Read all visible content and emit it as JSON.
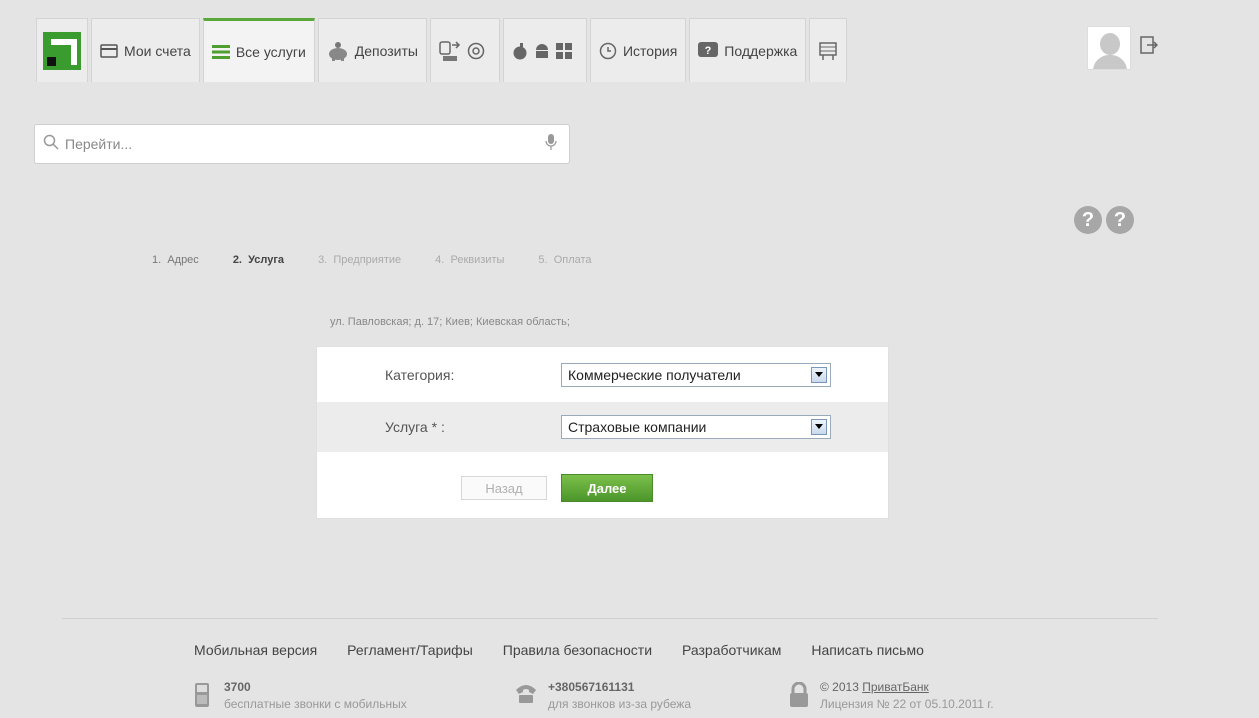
{
  "tabs": {
    "accounts_label": "Мои счета",
    "services_label": "Все услуги",
    "deposits_label": "Депозиты",
    "history_label": "История",
    "support_label": "Поддержка"
  },
  "search": {
    "placeholder": "Перейти..."
  },
  "steps": [
    {
      "num": "1.",
      "label": "Адрес"
    },
    {
      "num": "2.",
      "label": "Услуга"
    },
    {
      "num": "3.",
      "label": "Предприятие"
    },
    {
      "num": "4.",
      "label": "Реквизиты"
    },
    {
      "num": "5.",
      "label": "Оплата"
    }
  ],
  "address": "ул. Павловская; д. 17; Киев; Киевская область;",
  "form": {
    "category_label": "Категория:",
    "category_value": "Коммерческие получатели",
    "service_label": "Услуга * :",
    "service_value": "Страховые компании",
    "back_label": "Назад",
    "next_label": "Далее"
  },
  "footer": {
    "links": [
      "Мобильная версия",
      "Регламент/Тарифы",
      "Правила безопасности",
      "Разработчикам",
      "Написать письмо"
    ],
    "phone_short": "3700",
    "phone_short_note": "бесплатные звонки с мобильных",
    "phone_intl": "+380567161131",
    "phone_intl_note": "для звонков из-за рубежа",
    "copyright": "© 2013",
    "bank_link": "ПриватБанк",
    "license": "Лицензия № 22 от 05.10.2011 г."
  },
  "colors": {
    "accent": "#5aa83a",
    "brand": "#3a9b2f"
  }
}
